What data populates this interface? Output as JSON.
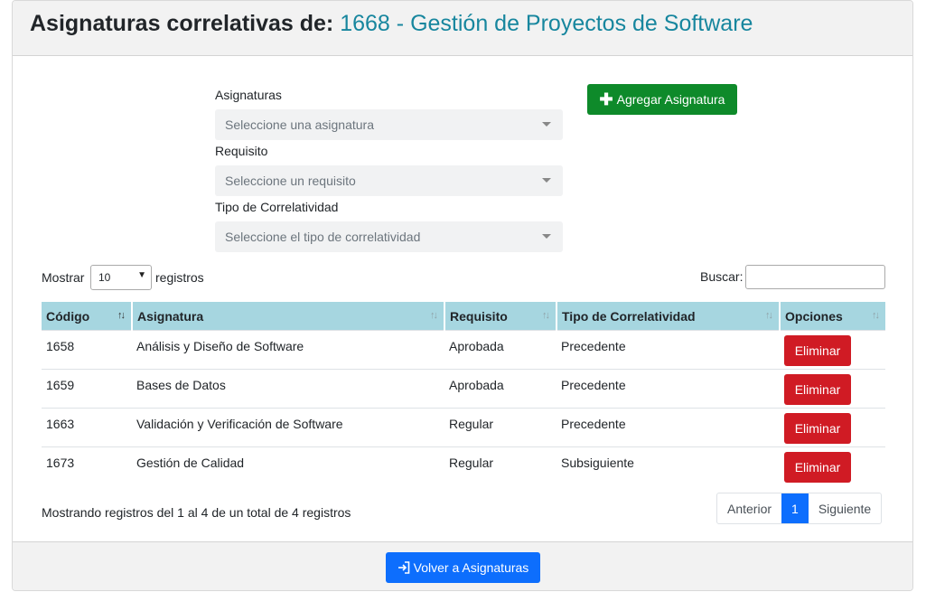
{
  "header": {
    "title_prefix": "Asignaturas correlativas de:",
    "subject_code": "1668",
    "separator": "-",
    "subject_name": "Gestión de Proyectos de Software"
  },
  "form": {
    "asignaturas_label": "Asignaturas",
    "asignaturas_placeholder": "Seleccione una asignatura",
    "requisito_label": "Requisito",
    "requisito_placeholder": "Seleccione un requisito",
    "tipo_label": "Tipo de Correlatividad",
    "tipo_placeholder": "Seleccione el tipo de correlatividad",
    "add_button_label": "Agregar Asignatura",
    "add_button_icon": "plus-icon"
  },
  "table_controls": {
    "show_label": "Mostrar",
    "page_length": "10",
    "records_label": "registros",
    "search_label": "Buscar:",
    "search_value": ""
  },
  "table": {
    "columns": [
      "Código",
      "Asignatura",
      "Requisito",
      "Tipo de Correlatividad",
      "Opciones"
    ],
    "rows": [
      {
        "codigo": "1658",
        "asignatura": "Análisis y Diseño de Software",
        "requisito": "Aprobada",
        "tipo": "Precedente",
        "accion": "Eliminar"
      },
      {
        "codigo": "1659",
        "asignatura": "Bases de Datos",
        "requisito": "Aprobada",
        "tipo": "Precedente",
        "accion": "Eliminar"
      },
      {
        "codigo": "1663",
        "asignatura": "Validación y Verificación de Software",
        "requisito": "Regular",
        "tipo": "Precedente",
        "accion": "Eliminar"
      },
      {
        "codigo": "1673",
        "asignatura": "Gestión de Calidad",
        "requisito": "Regular",
        "tipo": "Subsiguiente",
        "accion": "Eliminar"
      }
    ],
    "info": "Mostrando registros del 1 al 4 de un total de 4 registros"
  },
  "pagination": {
    "previous": "Anterior",
    "current_page": "1",
    "next": "Siguiente"
  },
  "footer": {
    "back_button_label": "Volver a Asignaturas",
    "back_button_icon": "sign-in-icon"
  },
  "colors": {
    "title_accent": "#17869e",
    "add_button": "#0e8a2a",
    "delete_button": "#d01b24",
    "primary": "#0d6efd",
    "table_header": "#a6d6e0"
  }
}
